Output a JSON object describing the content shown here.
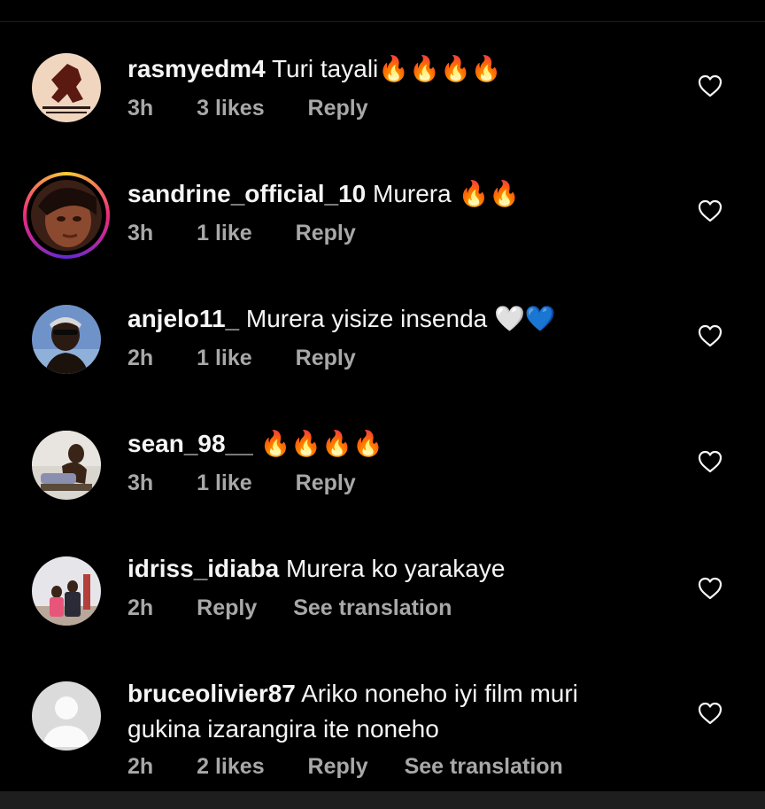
{
  "comments": [
    {
      "username": "rasmyedm4",
      "text": "Turi tayali🔥🔥🔥🔥",
      "time": "3h",
      "likes": "3 likes",
      "reply": "Reply",
      "translate": ""
    },
    {
      "username": "sandrine_official_10",
      "text": "Murera 🔥🔥",
      "time": "3h",
      "likes": "1 like",
      "reply": "Reply",
      "translate": ""
    },
    {
      "username": "anjelo11_",
      "text": "Murera yisize insenda 🤍💙",
      "time": "2h",
      "likes": "1 like",
      "reply": "Reply",
      "translate": ""
    },
    {
      "username": "sean_98__",
      "text": "🔥🔥🔥🔥",
      "time": "3h",
      "likes": "1 like",
      "reply": "Reply",
      "translate": ""
    },
    {
      "username": "idriss_idiaba",
      "text": "Murera ko yarakaye",
      "time": "2h",
      "likes": "",
      "reply": "Reply",
      "translate": "See translation"
    },
    {
      "username": "bruceolivier87",
      "text": "Ariko noneho iyi film muri gukina izarangira ite noneho",
      "time": "2h",
      "likes": "2 likes",
      "reply": "Reply",
      "translate": "See translation"
    }
  ],
  "avatars": {
    "icons": [
      "avatar-photo",
      "avatar-photo-story-ring",
      "avatar-photo",
      "avatar-photo",
      "avatar-photo",
      "default-avatar-icon"
    ]
  },
  "colors": {
    "background": "#000000",
    "text": "#f5f5f5",
    "meta": "#a8a8a8"
  }
}
